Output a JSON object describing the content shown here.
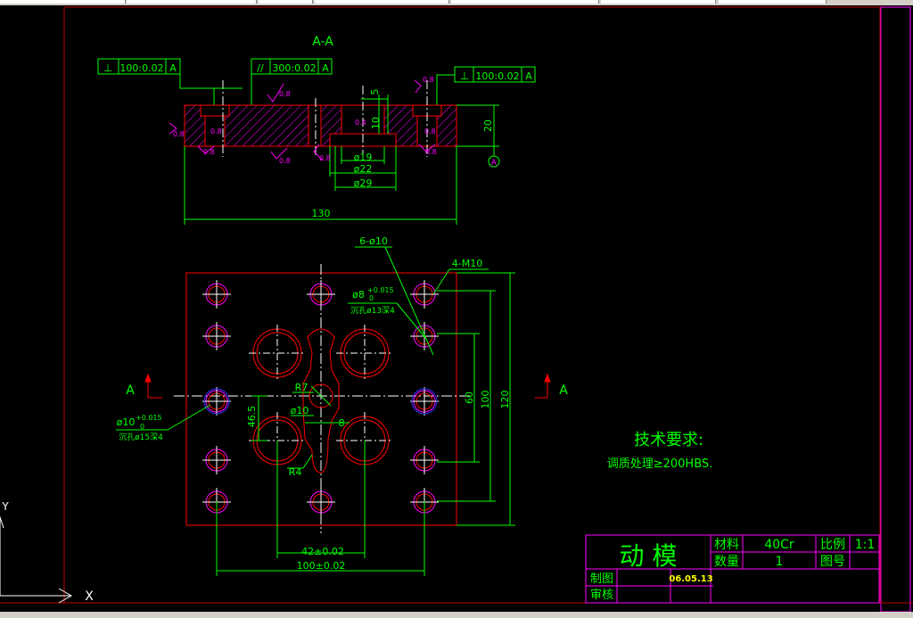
{
  "colors": {
    "background": "#000000",
    "frame": "#c00000",
    "border": "#ff00ff",
    "dimension": "#00ff00",
    "geometry": "#ff0000",
    "center": "#ffffff",
    "hatch": "#ff00ff",
    "text_green": "#00ff00",
    "ucs": "#ffffff"
  },
  "section": {
    "title": "A-A",
    "tolerance_left": {
      "symbol": "⊥",
      "value": "100:0.02",
      "datum": "A"
    },
    "tolerance_mid": {
      "symbol": "//",
      "value": "300:0.02",
      "datum": "A"
    },
    "tolerance_right": {
      "symbol": "⊥",
      "value": "100:0.02",
      "datum": "A"
    },
    "datum_label": "A",
    "dim_5": "5",
    "dim_10": "10",
    "dim_20": "20",
    "dim_d19": "ø19",
    "dim_d22": "ø22",
    "dim_d29": "ø29",
    "dim_130": "130",
    "roughness": [
      "0.8",
      "0.8",
      "0.8",
      "0.8",
      "0.8",
      "0.8",
      "0.8",
      "0.8",
      "0.4",
      "0.8"
    ]
  },
  "plan": {
    "holes_label": "6-ø10",
    "thread_label": "4-M10",
    "pin_label_main": "ø8",
    "pin_label_tol_upper": "+0.015",
    "pin_label_tol_lower": "0",
    "pin_label_note": "沉孔ø13深4",
    "left_hole_main": "ø10",
    "left_hole_tol_upper": "+0.015",
    "left_hole_tol_lower": "0",
    "left_hole_note": "沉孔ø15深4",
    "r7": "R7",
    "d10": "ø10",
    "r4": "R4",
    "dim_8": "8",
    "dim_46_5": "46.5",
    "dim_60": "60",
    "dim_100": "100",
    "dim_120": "120",
    "dim_42": "42±0.02",
    "dim_100_02": "100±0.02",
    "section_mark": "A"
  },
  "notes": {
    "title": "技术要求:",
    "line1": "调质处理≥200HBS."
  },
  "title_block": {
    "part_name": "动 模",
    "material_label": "材料",
    "material_value": "40Cr",
    "scale_label": "比例",
    "scale_value": "1:1",
    "qty_label": "数量",
    "qty_value": "1",
    "drawing_no_label": "图号",
    "drawn_label": "制图",
    "drawn_date": "06.05.13",
    "check_label": "审核"
  },
  "ucs": {
    "x_label": "X",
    "y_label": "Y"
  }
}
